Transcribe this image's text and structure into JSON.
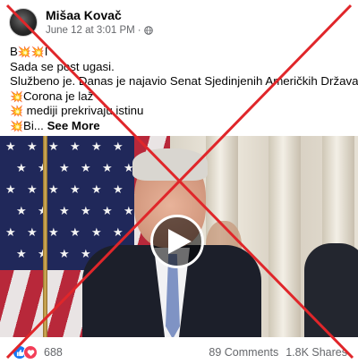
{
  "post": {
    "author": "Mišaa Kovač",
    "timestamp": "June 12 at 3:01 PM",
    "separator": "·",
    "privacy_icon": "globe-icon",
    "lines": {
      "l1_prefix": "B",
      "l1_suffix": "I",
      "l2": "Sada se post ugasi.",
      "l3": "Službeno je. Danas je najavio Senat Sjedinjenih Američkih Država:",
      "l4": "Corona je laž",
      "l5": "mediji prekrivaju istinu",
      "l6": "Bi...",
      "see_more": "See More"
    },
    "emoji_icon": "explosion-emoji-icon"
  },
  "video": {
    "play_icon": "play-icon"
  },
  "overlay": {
    "cross_color": "#e0262a"
  },
  "footer": {
    "reaction_count": "688",
    "comments": "89 Comments",
    "shares": "1.8K Shares"
  },
  "colors": {
    "like": "#1877f2",
    "love": "#f33e58",
    "secondary_text": "#65676b"
  }
}
